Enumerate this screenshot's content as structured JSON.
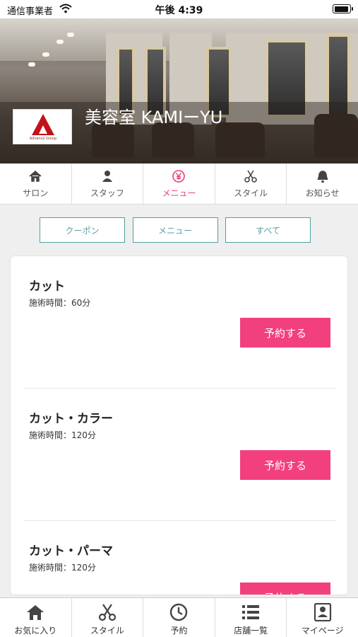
{
  "status_bar": {
    "carrier": "通信事業者",
    "time": "午後 4:39"
  },
  "header": {
    "shop_name": "美容室 KAMIーYU",
    "logo_caption": "Advance Group"
  },
  "category_tabs": [
    {
      "label": "サロン",
      "icon": "home-icon",
      "active": false
    },
    {
      "label": "スタッフ",
      "icon": "person-icon",
      "active": false
    },
    {
      "label": "メニュー",
      "icon": "yen-icon",
      "active": true
    },
    {
      "label": "スタイル",
      "icon": "scissors-icon",
      "active": false
    },
    {
      "label": "お知らせ",
      "icon": "bell-icon",
      "active": false
    }
  ],
  "filters": [
    "クーポン",
    "メニュー",
    "すべて"
  ],
  "menu_items": [
    {
      "name": "カット",
      "duration": "施術時間：60分",
      "button": "予約する"
    },
    {
      "name": "カット・カラー",
      "duration": "施術時間：120分",
      "button": "予約する"
    },
    {
      "name": "カット・パーマ",
      "duration": "施術時間：120分",
      "button": "予約する"
    }
  ],
  "bottom_nav": [
    {
      "label": "お気に入り",
      "icon": "home-icon"
    },
    {
      "label": "スタイル",
      "icon": "scissors-icon"
    },
    {
      "label": "予約",
      "icon": "clock-icon"
    },
    {
      "label": "店舗一覧",
      "icon": "list-icon"
    },
    {
      "label": "マイページ",
      "icon": "profile-icon"
    }
  ],
  "colors": {
    "accent_pink": "#f2407f",
    "filter_teal": "#4fa0a0",
    "logo_red": "#c1121b"
  }
}
